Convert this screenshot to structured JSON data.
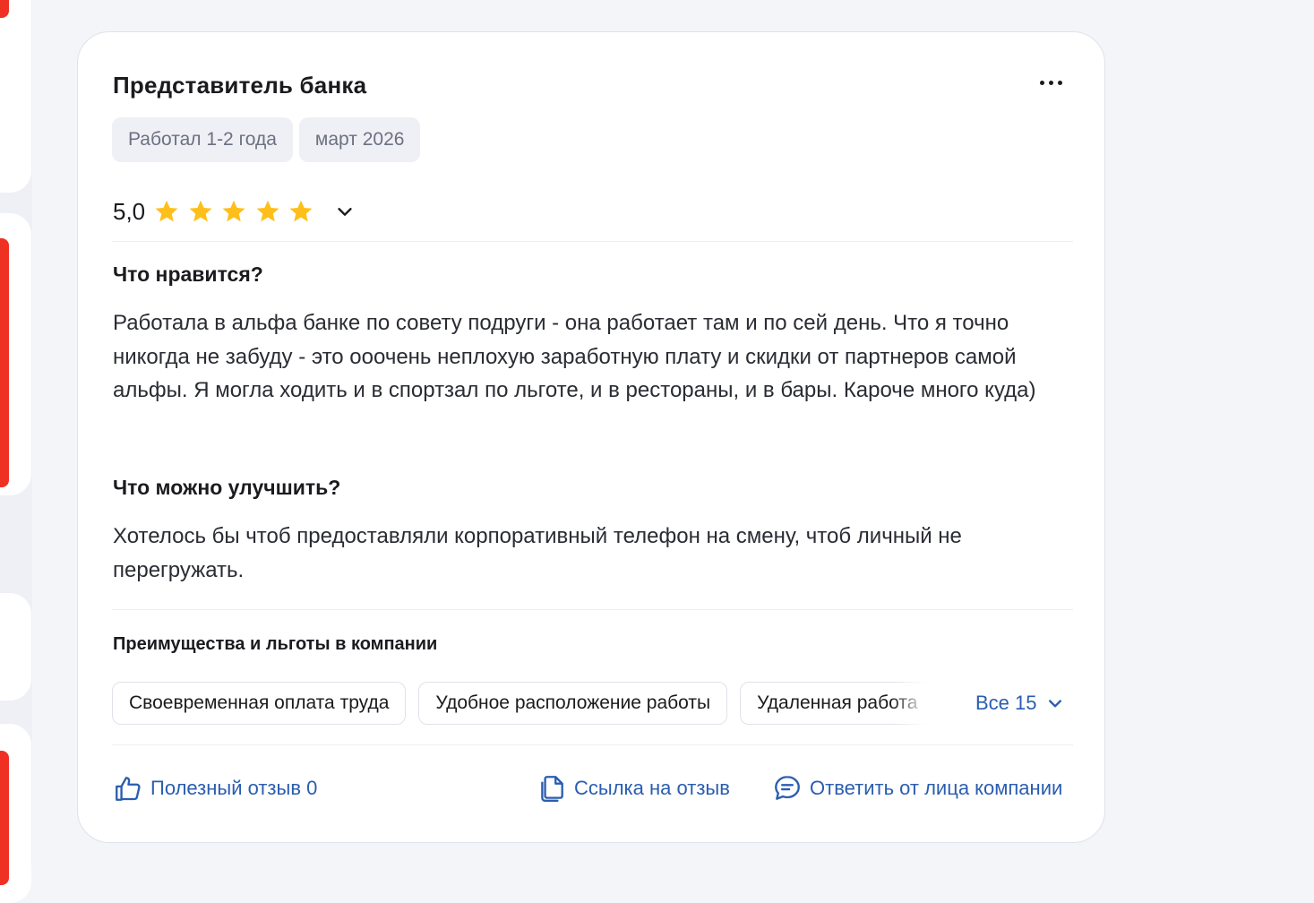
{
  "review": {
    "author_title": "Представитель банка",
    "tags": [
      "Работал 1-2 года",
      "март 2026"
    ],
    "rating": "5,0",
    "stars": 5,
    "likes_title": "Что нравится?",
    "likes_text": "Работала в альфа банке по совету подруги - она работает там и по сей день. Что я точно никогда не забуду - это ооочень неплохую заработную плату и скидки от партнеров самой альфы. Я могла ходить и в спортзал по льготе, и в рестораны, и в бары. Кароче много куда)",
    "improve_title": "Что можно улучшить?",
    "improve_text": "Хотелось бы чтоб предоставляли корпоративный телефон на смену, чтоб личный не перегружать."
  },
  "benefits": {
    "title": "Преимущества и льготы в компании",
    "chips": [
      "Своевременная оплата труда",
      "Удобное расположение работы",
      "Удаленная работа"
    ],
    "all_label": "Все 15"
  },
  "actions": {
    "helpful_label": "Полезный отзыв 0",
    "link_label": "Ссылка на отзыв",
    "reply_label": "Ответить от лица компании"
  },
  "colors": {
    "accent": "#2a5db0",
    "star": "#ffbf1a",
    "brand_red": "#ef3124"
  },
  "icons": [
    "more-icon",
    "star-icon",
    "chevron-down-icon",
    "thumbs-up-icon",
    "copy-link-icon",
    "chat-bubble-icon"
  ]
}
